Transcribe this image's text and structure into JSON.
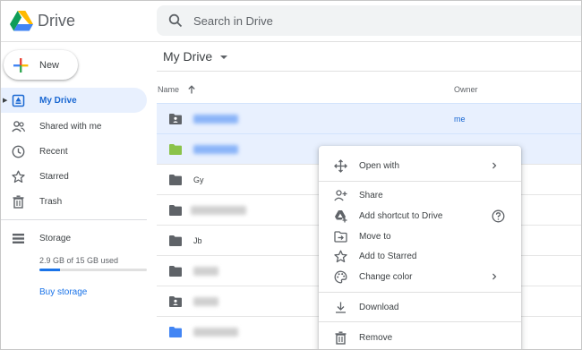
{
  "app": {
    "name": "Drive"
  },
  "search": {
    "placeholder": "Search in Drive"
  },
  "new_button": {
    "label": "New"
  },
  "sidebar": {
    "items": [
      {
        "label": "My Drive",
        "icon": "my-drive-icon",
        "active": true
      },
      {
        "label": "Shared with me",
        "icon": "people-icon"
      },
      {
        "label": "Recent",
        "icon": "clock-icon"
      },
      {
        "label": "Starred",
        "icon": "star-icon"
      },
      {
        "label": "Trash",
        "icon": "trash-icon"
      }
    ],
    "storage": {
      "label": "Storage",
      "used_text": "2.9 GB of 15 GB used",
      "used_fraction": 0.193,
      "buy_label": "Buy storage"
    }
  },
  "main": {
    "breadcrumb": "My Drive",
    "columns": {
      "name": "Name",
      "owner": "Owner"
    },
    "rows": [
      {
        "name": "",
        "icon": "shared-folder-icon",
        "owner": "me",
        "selected": true
      },
      {
        "name": "",
        "icon": "green-folder-icon",
        "selected": true
      },
      {
        "name": "Gy",
        "icon": "folder-icon"
      },
      {
        "name": "",
        "icon": "folder-icon"
      },
      {
        "name": "Jb",
        "icon": "folder-icon"
      },
      {
        "name": "",
        "icon": "folder-icon"
      },
      {
        "name": "",
        "icon": "shared-folder-icon"
      },
      {
        "name": "",
        "icon": "blue-folder-icon"
      }
    ]
  },
  "context_menu": {
    "items": [
      {
        "label": "Open with",
        "icon": "open-with-icon",
        "submenu": true
      },
      {
        "label": "Share",
        "icon": "share-icon"
      },
      {
        "label": "Add shortcut to Drive",
        "icon": "add-shortcut-icon",
        "help": true
      },
      {
        "label": "Move to",
        "icon": "move-to-icon"
      },
      {
        "label": "Add to Starred",
        "icon": "star-icon"
      },
      {
        "label": "Change color",
        "icon": "palette-icon",
        "submenu": true
      },
      {
        "label": "Download",
        "icon": "download-icon"
      },
      {
        "label": "Remove",
        "icon": "trash-icon"
      }
    ]
  },
  "colors": {
    "accent": "#1a73e8",
    "selected_bg": "#e8f0fe",
    "folder": "#5f6368",
    "green_folder": "#8bc34a",
    "blue_folder": "#4285f4"
  }
}
